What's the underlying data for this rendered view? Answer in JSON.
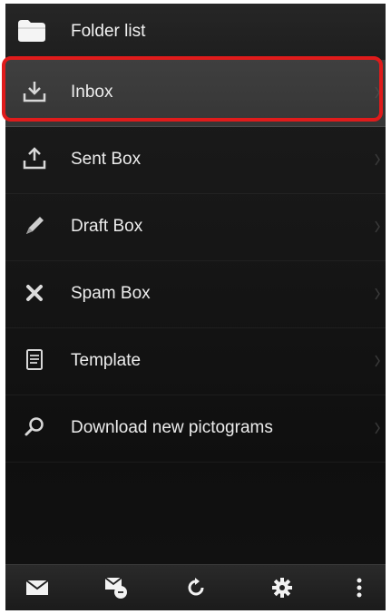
{
  "header": {
    "title": "Folder list",
    "icon": "folder-list-icon"
  },
  "menu": {
    "items": [
      {
        "label": "Inbox",
        "icon": "inbox-download-icon",
        "selected": true
      },
      {
        "label": "Sent Box",
        "icon": "sent-upload-icon",
        "selected": false
      },
      {
        "label": "Draft Box",
        "icon": "pencil-icon",
        "selected": false
      },
      {
        "label": "Spam Box",
        "icon": "x-cross-icon",
        "selected": false
      },
      {
        "label": "Template",
        "icon": "document-icon",
        "selected": false
      },
      {
        "label": "Download new pictograms",
        "icon": "search-icon",
        "selected": false
      }
    ]
  },
  "bottom_bar": {
    "buttons": [
      {
        "icon": "mail-icon"
      },
      {
        "icon": "compose-mail-icon"
      },
      {
        "icon": "refresh-icon"
      },
      {
        "icon": "gear-icon"
      },
      {
        "icon": "more-vert-icon"
      }
    ]
  },
  "colors": {
    "highlight": "#e01b1b",
    "text": "#ededed",
    "background": "#161616"
  }
}
